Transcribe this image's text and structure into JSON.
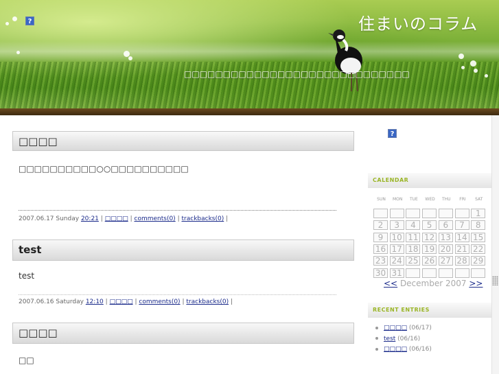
{
  "header": {
    "title": "住まいのコラム",
    "description": "□□□□□□□□□□□□□□□□□□□□□□□□□□□□□",
    "icon": "broken-image-icon"
  },
  "posts": [
    {
      "title": "□□□□",
      "body": "□□□□□□□□□□○○□□□□□□□□□□",
      "date": "2007.06.17 Sunday",
      "time": "20:21",
      "author": "□□□□",
      "comments": "comments(0)",
      "trackbacks": "trackbacks(0)"
    },
    {
      "title": "test",
      "body": "test",
      "date": "2007.06.16 Saturday",
      "time": "12:10",
      "author": "□□□□",
      "comments": "comments(0)",
      "trackbacks": "trackbacks(0)"
    },
    {
      "title": "□□□□",
      "body": "□□"
    }
  ],
  "sep": "|",
  "sidebar": {
    "icon": "broken-image-icon",
    "calendar_heading": "CALENDAR",
    "days_of_week": [
      "SUN",
      "MON",
      "TUE",
      "WED",
      "THU",
      "FRI",
      "SAT"
    ],
    "weeks": [
      [
        "",
        "",
        "",
        "",
        "",
        "",
        "1"
      ],
      [
        "2",
        "3",
        "4",
        "5",
        "6",
        "7",
        "8"
      ],
      [
        "9",
        "10",
        "11",
        "12",
        "13",
        "14",
        "15"
      ],
      [
        "16",
        "17",
        "18",
        "19",
        "20",
        "21",
        "22"
      ],
      [
        "23",
        "24",
        "25",
        "26",
        "27",
        "28",
        "29"
      ],
      [
        "30",
        "31",
        "",
        "",
        "",
        "",
        ""
      ]
    ],
    "prev_label": "<<",
    "month_label": "December 2007",
    "next_label": ">>",
    "recent_heading": "RECENT ENTRIES",
    "recent_entries": [
      {
        "title": "□□□□",
        "date": "(06/17)"
      },
      {
        "title": "test",
        "date": "(06/16)"
      },
      {
        "title": "□□□□",
        "date": "(06/16)"
      }
    ]
  },
  "colors": {
    "accent_green": "#9ab526",
    "link": "#1a2a8a",
    "header_bar": "#4a3215"
  }
}
